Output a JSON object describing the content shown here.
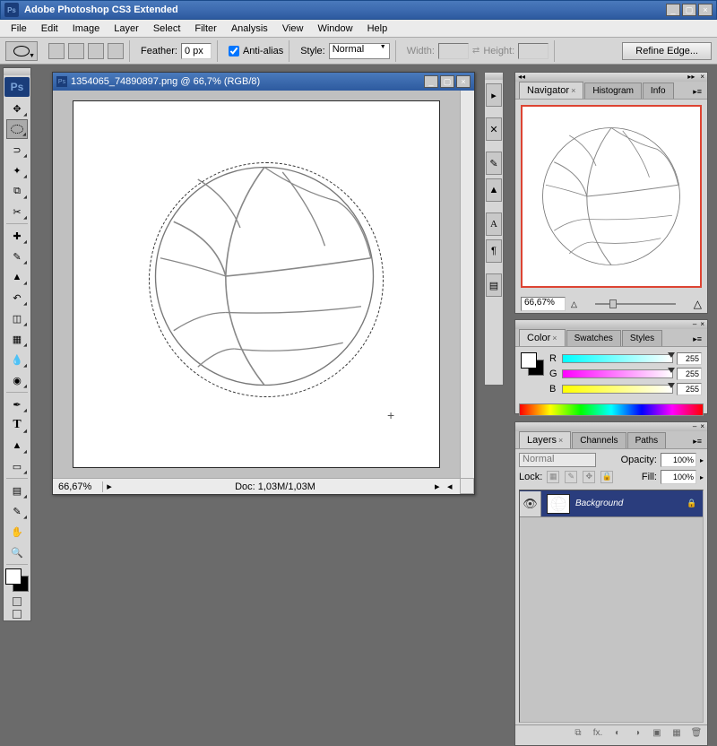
{
  "app": {
    "title": "Adobe Photoshop CS3 Extended",
    "logo": "Ps"
  },
  "menu": [
    "File",
    "Edit",
    "Image",
    "Layer",
    "Select",
    "Filter",
    "Analysis",
    "View",
    "Window",
    "Help"
  ],
  "options": {
    "feather_label": "Feather:",
    "feather_value": "0 px",
    "antialias_label": "Anti-alias",
    "style_label": "Style:",
    "style_value": "Normal",
    "width_label": "Width:",
    "height_label": "Height:",
    "refine_label": "Refine Edge..."
  },
  "document": {
    "title": "1354065_74890897.png @ 66,7% (RGB/8)",
    "zoom": "66,67%",
    "info": "Doc: 1,03M/1,03M"
  },
  "navigator": {
    "tab1": "Navigator",
    "tab2": "Histogram",
    "tab3": "Info",
    "zoom": "66,67%"
  },
  "color": {
    "tab1": "Color",
    "tab2": "Swatches",
    "tab3": "Styles",
    "r_label": "R",
    "g_label": "G",
    "b_label": "B",
    "r_val": "255",
    "g_val": "255",
    "b_val": "255"
  },
  "layers": {
    "tab1": "Layers",
    "tab2": "Channels",
    "tab3": "Paths",
    "blend": "Normal",
    "opacity_label": "Opacity:",
    "opacity_val": "100%",
    "lock_label": "Lock:",
    "fill_label": "Fill:",
    "fill_val": "100%",
    "bg_layer": "Background"
  }
}
